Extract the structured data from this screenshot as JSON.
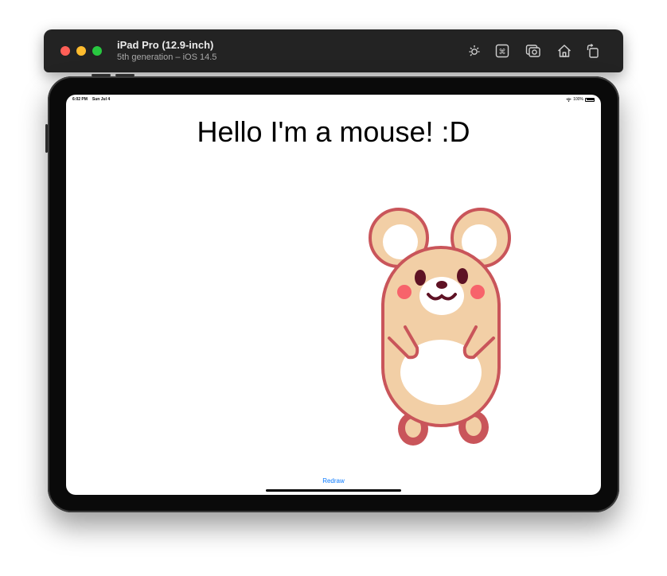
{
  "titlebar": {
    "device_name": "iPad Pro (12.9-inch)",
    "device_detail": "5th generation – iOS 14.5",
    "icons": [
      "brightness-icon",
      "command-icon",
      "screenshot-icon",
      "home-icon",
      "rotate-icon"
    ]
  },
  "status_bar": {
    "time": "6:02 PM",
    "date": "Sun Jul 4",
    "battery": "100%"
  },
  "app": {
    "headline": "Hello I'm a mouse! :D",
    "redraw_label": "Redraw"
  },
  "colors": {
    "mouse_fill": "#f2cfa6",
    "mouse_outline": "#c9555a",
    "cheeks": "#f7636b",
    "eyes": "#5e1224",
    "link": "#0a7aff"
  }
}
